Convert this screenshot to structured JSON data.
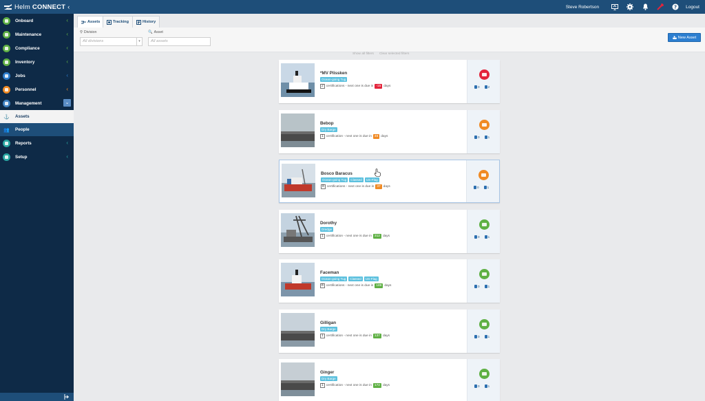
{
  "app": {
    "brand_light": "Helm",
    "brand_bold": "CONNECT"
  },
  "topbar": {
    "user": "Steve Robertson",
    "logout": "Logout",
    "icons": [
      "presentation-icon",
      "gear-icon",
      "bell-icon",
      "wrench-icon",
      "help-icon"
    ]
  },
  "sidebar": {
    "items": [
      {
        "label": "Onboard",
        "color": "#5fb044"
      },
      {
        "label": "Maintenance",
        "color": "#5fb044"
      },
      {
        "label": "Compliance",
        "color": "#5fb044"
      },
      {
        "label": "Inventory",
        "color": "#5fb044"
      },
      {
        "label": "Jobs",
        "color": "#2d7fd0"
      },
      {
        "label": "Personnel",
        "color": "#f08a24"
      },
      {
        "label": "Management",
        "color": "#3f82c2"
      }
    ],
    "sub": [
      {
        "label": "Assets"
      },
      {
        "label": "People"
      },
      {
        "label": "Reports"
      },
      {
        "label": "Setup"
      }
    ]
  },
  "tabs": [
    {
      "label": "Assets"
    },
    {
      "label": "Tracking"
    },
    {
      "label": "History"
    }
  ],
  "filters": {
    "division_label": "Division",
    "division_placeholder": "All divisions",
    "asset_label": "Asset",
    "asset_placeholder": "All assets",
    "show_all": "Show all filters",
    "clear_selected": "Clear selected filters"
  },
  "new_asset": "New Asset",
  "colors": {
    "red": "#e3243b",
    "orange": "#f08a24",
    "green": "#5fb044",
    "tag": "#5bc0de",
    "accent": "#1e4e79"
  },
  "assets": [
    {
      "name": "*MV Plissken",
      "tags": [
        "Ocean-going Tug"
      ],
      "count": "2",
      "cert_text": "certifications - next one is due in",
      "due": "-15",
      "due_color": "#e3243b",
      "days": "days",
      "status_color": "#e3243b",
      "c1": "0",
      "c2": "2"
    },
    {
      "name": "Bebop",
      "tags": [
        "Dry Barge"
      ],
      "count": "1",
      "cert_text": "certification - next one is due in",
      "due": "46",
      "due_color": "#f08a24",
      "days": "days",
      "status_color": "#f08a24",
      "c1": "0",
      "c2": "1"
    },
    {
      "name": "Bosco Baracus",
      "tags": [
        "Ocean-going Tug",
        "Classed",
        "US-Flag"
      ],
      "count": "8",
      "cert_text": "certifications - next one is due in",
      "due": "37",
      "due_color": "#f08a24",
      "days": "days",
      "status_color": "#f08a24",
      "c1": "0",
      "c2": "1"
    },
    {
      "name": "Dorothy",
      "tags": [
        "Dredge"
      ],
      "count": "1",
      "cert_text": "certification - next one is due in",
      "due": "312",
      "due_color": "#5fb044",
      "days": "days",
      "status_color": "#5fb044",
      "c1": "0",
      "c2": "1"
    },
    {
      "name": "Faceman",
      "tags": [
        "Ocean-going Tug",
        "Classed",
        "US-Flag"
      ],
      "count": "8",
      "cert_text": "certifications - next one is due in",
      "due": "189",
      "due_color": "#5fb044",
      "days": "days",
      "status_color": "#5fb044",
      "c1": "0",
      "c2": "1"
    },
    {
      "name": "Gilligan",
      "tags": [
        "Dry Barge"
      ],
      "count": "1",
      "cert_text": "certification - next one is due in",
      "due": "137",
      "due_color": "#5fb044",
      "days": "days",
      "status_color": "#5fb044",
      "c1": "0",
      "c2": "1"
    },
    {
      "name": "Ginger",
      "tags": [
        "Dry Barge"
      ],
      "count": "1",
      "cert_text": "certification - next one is due in",
      "due": "172",
      "due_color": "#5fb044",
      "days": "days",
      "status_color": "#5fb044",
      "c1": "0",
      "c2": "1"
    }
  ]
}
